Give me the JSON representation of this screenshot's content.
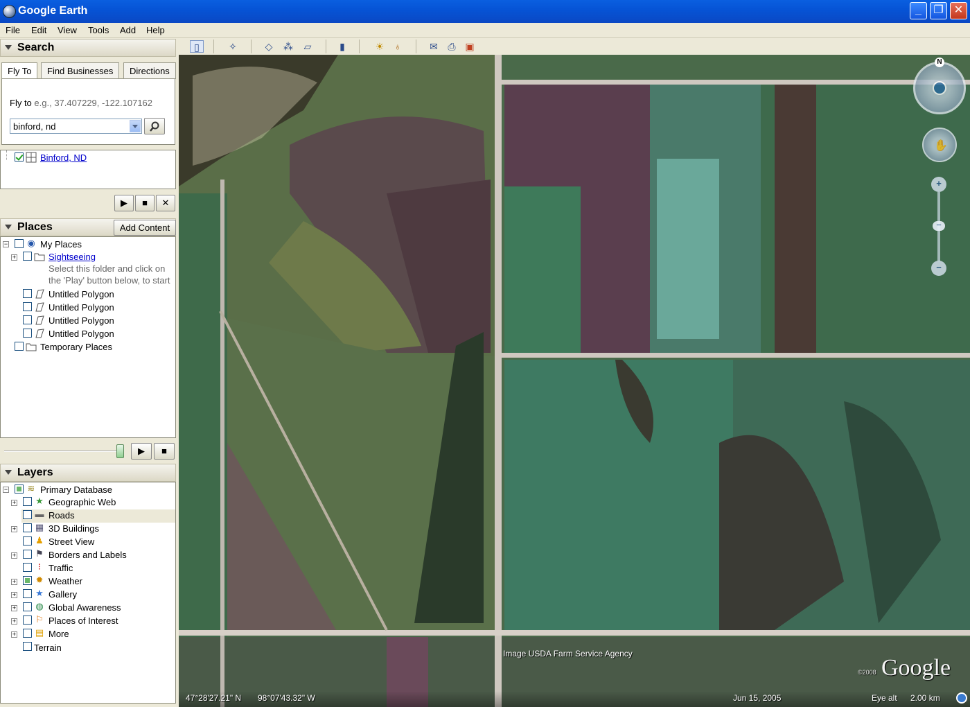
{
  "window": {
    "title": "Google Earth",
    "minimize": "_",
    "maximize": "❐",
    "close": "✕"
  },
  "menu": [
    "File",
    "Edit",
    "View",
    "Tools",
    "Add",
    "Help"
  ],
  "search": {
    "header": "Search",
    "tabs": [
      "Fly To",
      "Find Businesses",
      "Directions"
    ],
    "fly_to_label": "Fly to",
    "fly_to_hint": "e.g., 37.407229, -122.107162",
    "input_value": "binford, nd",
    "result": "Binford, ND"
  },
  "places": {
    "header": "Places",
    "add_content": "Add Content",
    "items": {
      "my_places": "My Places",
      "sightseeing": "Sightseeing",
      "sightseeing_desc1": "Select this folder and click on",
      "sightseeing_desc2": "the 'Play' button below, to start",
      "polygon1": "Untitled Polygon",
      "polygon2": "Untitled Polygon",
      "polygon3": "Untitled Polygon",
      "polygon4": "Untitled Polygon",
      "temporary": "Temporary Places"
    }
  },
  "layers": {
    "header": "Layers",
    "items": {
      "primary": "Primary Database",
      "geoweb": "Geographic Web",
      "roads": "Roads",
      "buildings": "3D Buildings",
      "streetview": "Street View",
      "borders": "Borders and Labels",
      "traffic": "Traffic",
      "weather": "Weather",
      "gallery": "Gallery",
      "global": "Global Awareness",
      "poi": "Places of Interest",
      "more": "More",
      "terrain": "Terrain"
    }
  },
  "map": {
    "attribution": "Image USDA Farm Service Agency",
    "copyright": "©2008",
    "logo": "Google",
    "lat": "47°28'27.21\" N",
    "lon": "98°07'43.32\" W",
    "date": "Jun 15, 2005",
    "eye_alt_label": "Eye alt",
    "eye_alt_value": "2.00 km",
    "north": "N"
  },
  "colors": {
    "title_bar": "#0654d6",
    "panel": "#ece9d8",
    "link": "#0000cc"
  }
}
